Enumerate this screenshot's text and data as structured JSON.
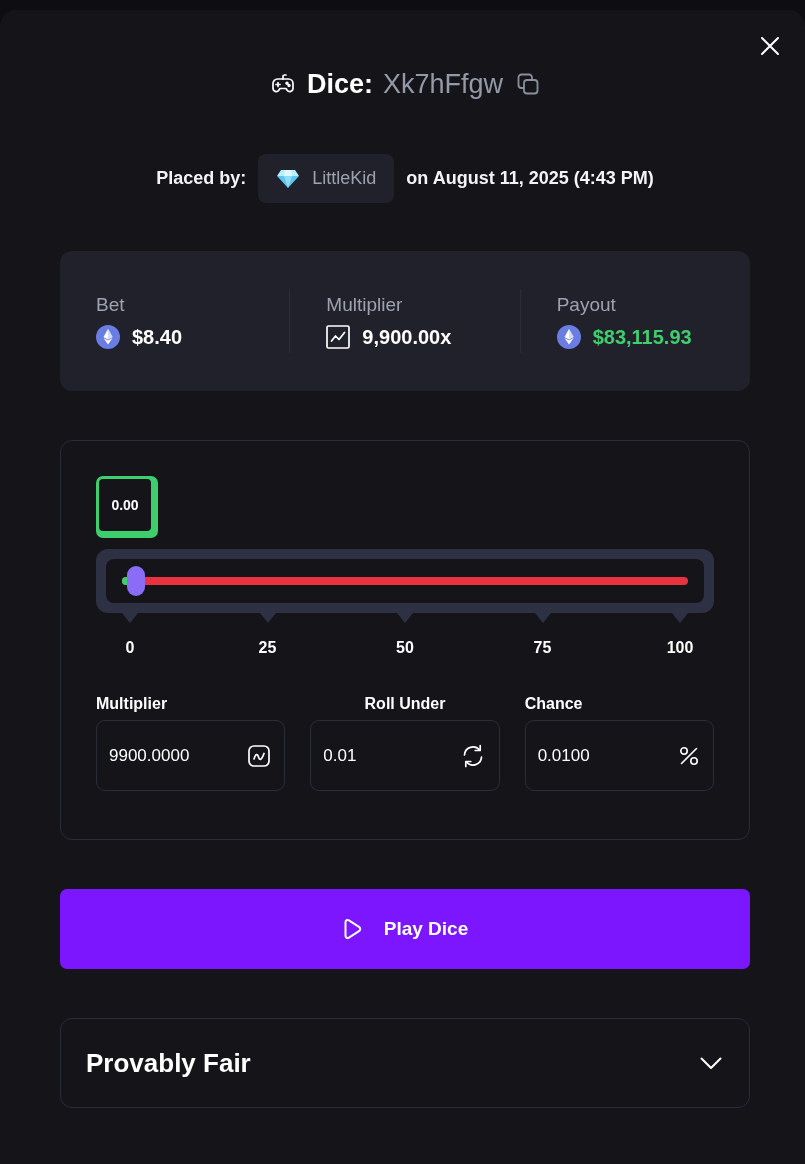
{
  "header": {
    "game": "Dice:",
    "bet_id": "Xk7hFfgw"
  },
  "placed": {
    "label": "Placed by:",
    "user": "LittleKid",
    "date": "on August 11, 2025 (4:43 PM)"
  },
  "stats": [
    {
      "kind": "currency",
      "label": "Bet",
      "value": "$8.40",
      "color": "#ffffff"
    },
    {
      "kind": "multiplier",
      "label": "Multiplier",
      "value": "9,900.00x",
      "color": "#ffffff"
    },
    {
      "kind": "currency",
      "label": "Payout",
      "value": "$83,115.93",
      "color": "#3fce6e"
    }
  ],
  "game": {
    "result": {
      "value": "0.00",
      "win": true
    },
    "slider": {
      "level": 0.01
    },
    "ticks": [
      "0",
      "25",
      "50",
      "75",
      "100"
    ],
    "fields": [
      {
        "kind": "multiplier",
        "label": "Multiplier",
        "value": "9900.0000"
      },
      {
        "kind": "roll",
        "label": "Roll Under",
        "value": "0.01"
      },
      {
        "kind": "chance",
        "label": "Chance",
        "value": "0.0100"
      }
    ]
  },
  "play_button": {
    "label": "Play Dice"
  },
  "provably_fair": {
    "title": "Provably Fair",
    "expanded": false
  }
}
